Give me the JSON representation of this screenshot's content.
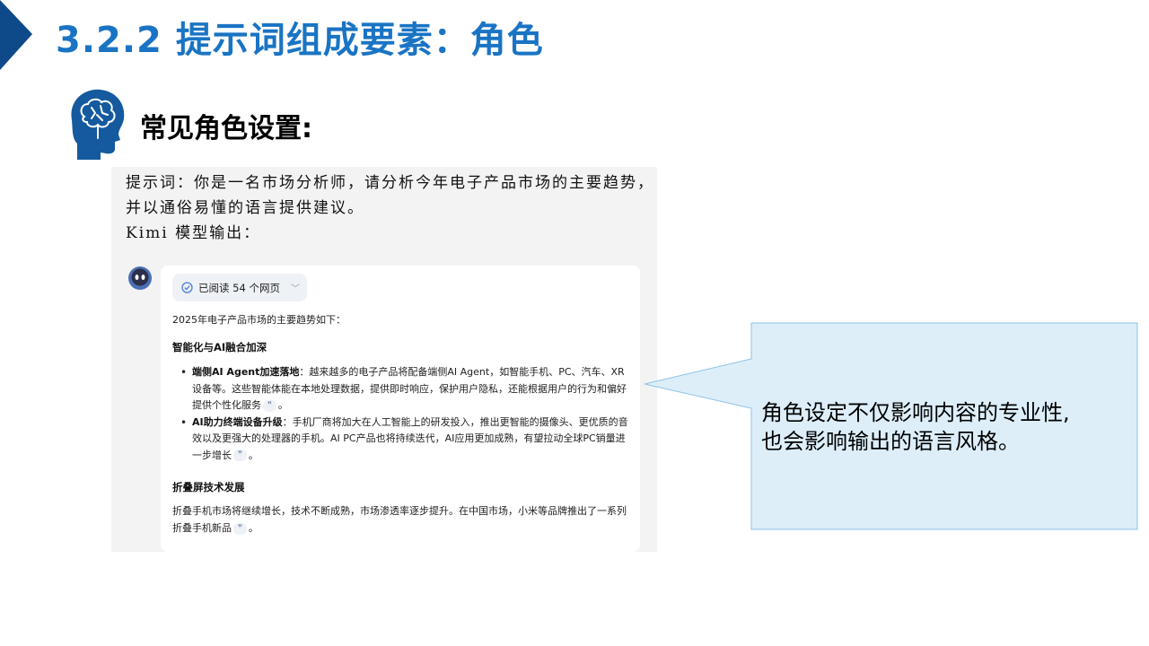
{
  "slide": {
    "title": "3.2.2 提示词组成要素：角色",
    "section_heading": "常见角色设置:"
  },
  "prompt": {
    "lines": [
      "提示词：你是一名市场分析师，请分析今年电子产品市场的主要趋势，",
      "并以通俗易懂的语言提供建议。",
      "Kimi 模型输出："
    ]
  },
  "chat": {
    "read_chip": "已阅读 54 个网页",
    "intro": "2025年电子产品市场的主要趋势如下：",
    "section1_heading": "智能化与AI融合加深",
    "bullets": [
      {
        "bold": "端侧AI Agent加速落地",
        "text": "：越来越多的电子产品将配备端侧AI Agent，如智能手机、PC、汽车、XR设备等。这些智能体能在本地处理数据，提供即时响应，保护用户隐私，还能根据用户的行为和偏好提供个性化服务",
        "end": "。"
      },
      {
        "bold": "AI助力终端设备升级",
        "text": "：手机厂商将加大在人工智能上的研发投入，推出更智能的摄像头、更优质的音效以及更强大的处理器的手机。AI PC产品也将持续迭代，AI应用更加成熟，有望拉动全球PC销量进一步增长",
        "end": "。"
      }
    ],
    "section2_heading": "折叠屏技术发展",
    "section2_text": "折叠手机市场将继续增长，技术不断成熟，市场渗透率逐步提升。在中国市场，小米等品牌推出了一系列折叠手机新品",
    "section2_end": "。",
    "cite_mark": "❞"
  },
  "callout": {
    "text_line1": "角色设定不仅影响内容的专业性,",
    "text_line2": "也会影响输出的语言风格。"
  },
  "colors": {
    "title_blue": "#1a74c4",
    "callout_fill": "#ddeef9",
    "callout_border": "#8ec3e6",
    "corner_navy": "#0e4a8a"
  },
  "icons": [
    "brain-head-icon",
    "kimi-avatar-icon",
    "check-circle-icon",
    "chevron-down-icon",
    "quote-citation-icon"
  ]
}
